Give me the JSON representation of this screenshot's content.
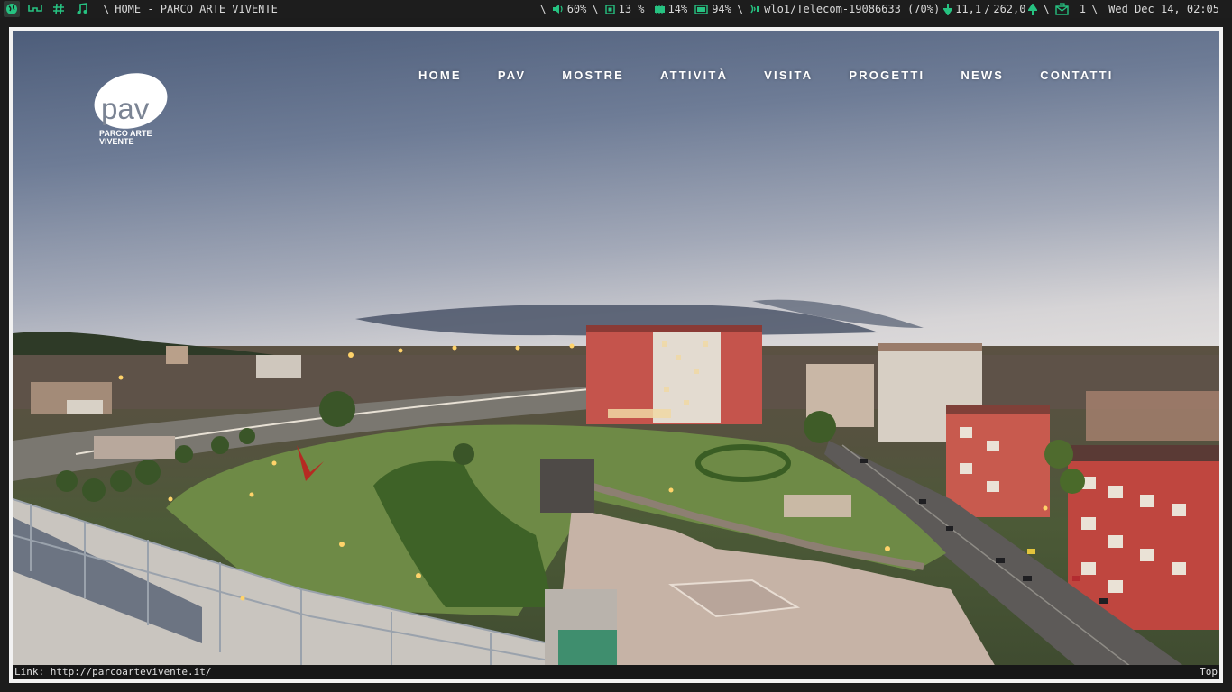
{
  "statusbar": {
    "page_title": "HOME - PARCO ARTE VIVENTE",
    "volume": "60%",
    "cpu": "13 %",
    "memory": "14%",
    "battery": "94%",
    "network": "wlo1/Telecom-19086633 (70%)",
    "download": "11,1",
    "upload": "262,0",
    "mail_count": "1",
    "datetime": "Wed Dec 14, 02:05",
    "icons": [
      "globe-icon",
      "glasses-icon",
      "hash-icon",
      "music-icon",
      "speaker-icon",
      "cpu-icon",
      "memory-icon",
      "battery-icon",
      "wifi-icon",
      "download-arrow-icon",
      "upload-arrow-icon",
      "mail-icon"
    ],
    "accent_color": "#26c281"
  },
  "nav": {
    "items": [
      "HOME",
      "PAV",
      "MOSTRE",
      "ATTIVITÀ",
      "VISITA",
      "PROGETTI",
      "NEWS",
      "CONTATTI"
    ]
  },
  "logo": {
    "mark": "pav",
    "line1": "PARCO ARTE",
    "line2": "VIVENTE"
  },
  "linkbar": {
    "link": "Link: http://parcoartevivente.it/",
    "position": "Top"
  }
}
